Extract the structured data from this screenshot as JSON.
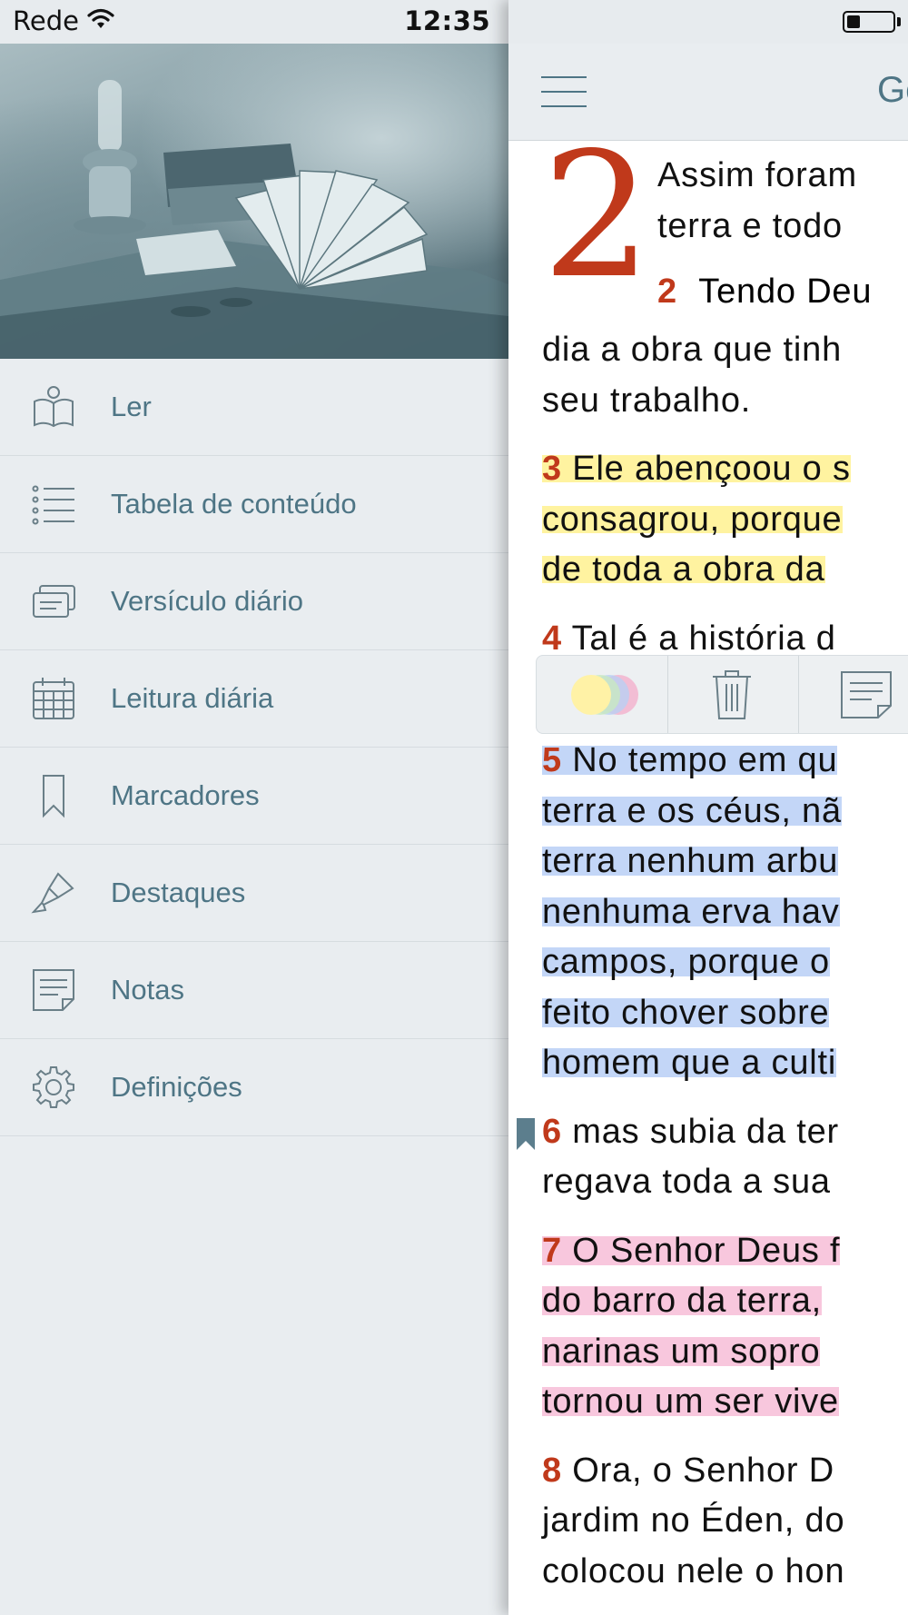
{
  "status_bar": {
    "carrier": "Rede",
    "time": "12:35"
  },
  "drawer": {
    "menu": [
      {
        "label": "Ler",
        "icon": "book-reader-icon"
      },
      {
        "label": "Tabela de conteúdo",
        "icon": "list-icon"
      },
      {
        "label": "Versículo diário",
        "icon": "card-stack-icon"
      },
      {
        "label": "Leitura diária",
        "icon": "calendar-icon"
      },
      {
        "label": "Marcadores",
        "icon": "bookmark-icon"
      },
      {
        "label": "Destaques",
        "icon": "highlighter-icon"
      },
      {
        "label": "Notas",
        "icon": "note-icon"
      },
      {
        "label": "Definições",
        "icon": "gear-icon"
      }
    ]
  },
  "reader": {
    "book_title": "Gé",
    "chapter": "2",
    "verse1_lines": [
      "Assim foram",
      "terra e todo"
    ],
    "verse2": {
      "num": "2",
      "line1": "Tendo Deu",
      "lines": [
        "dia a obra que tinh",
        "seu trabalho."
      ]
    },
    "verse3": {
      "num": "3",
      "line1": "Ele abençoou o s",
      "lines": [
        "consagrou, porque",
        "de toda a obra da"
      ],
      "highlight": "#fff3a0"
    },
    "verse4": {
      "num": "4",
      "line1": "Tal é a história d"
    },
    "verse5": {
      "num": "5",
      "line1": "No tempo em qu",
      "lines": [
        "terra e os céus, nã",
        "terra nenhum arbu",
        "nenhuma erva hav",
        "campos, porque o",
        "feito chover sobre",
        "homem que a culti"
      ],
      "highlight": "#c3d6f7"
    },
    "verse6": {
      "num": "6",
      "line1": "mas subia da ter",
      "lines": [
        "regava toda a sua"
      ]
    },
    "verse7": {
      "num": "7",
      "line1": "O Senhor Deus f",
      "lines": [
        "do barro da terra,",
        "narinas um sopro",
        "tornou um ser vive"
      ],
      "highlight": "#f8c7dd"
    },
    "verse8": {
      "num": "8",
      "line1": "Ora, o Senhor D",
      "lines": [
        "jardim no Éden, do",
        "colocou nele o hon"
      ]
    }
  },
  "accent_colors": {
    "verse_number": "#c0391b",
    "menu_text": "#4e7585"
  }
}
